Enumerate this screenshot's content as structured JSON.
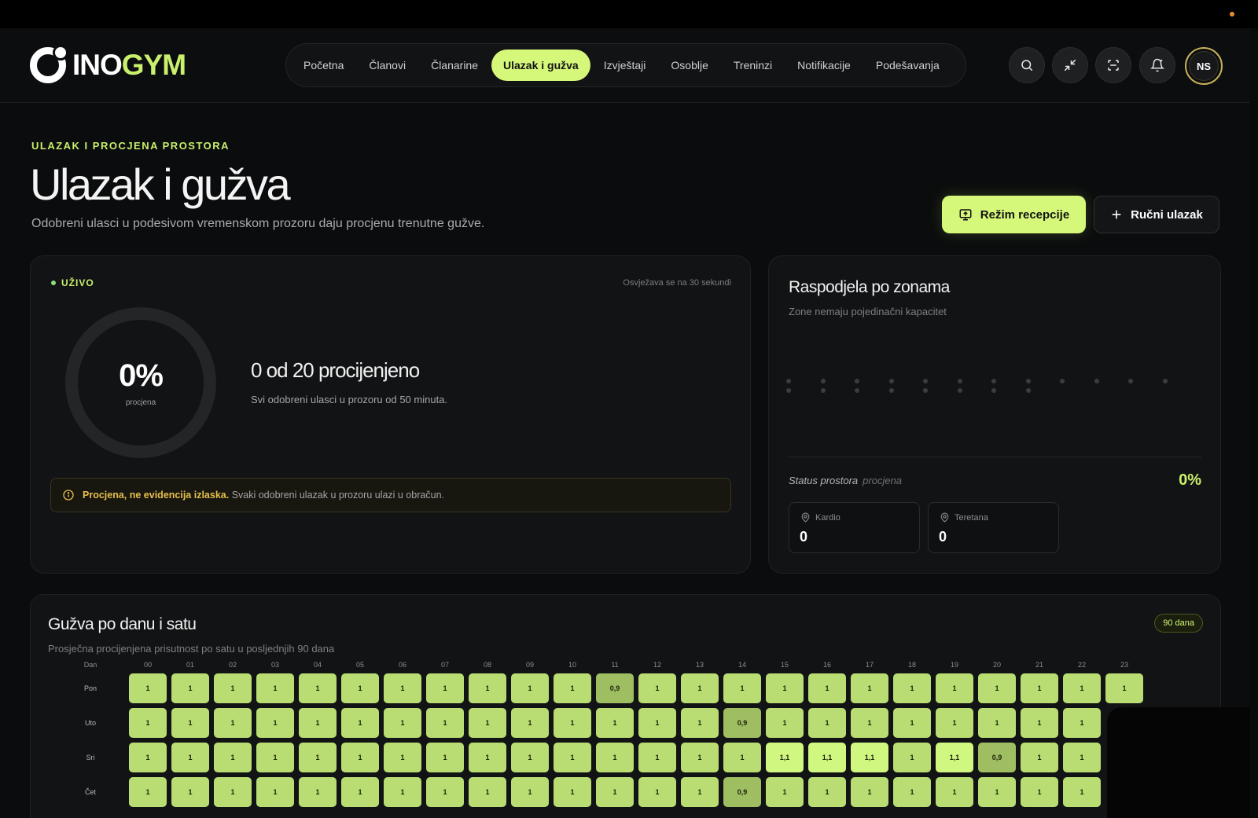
{
  "brand": {
    "logo_white": "INO",
    "logo_accent": "GYM",
    "accent": "#c9f06c"
  },
  "nav": [
    {
      "label": "Početna",
      "active": false
    },
    {
      "label": "Članovi",
      "active": false
    },
    {
      "label": "Članarine",
      "active": false
    },
    {
      "label": "Ulazak i gužva",
      "active": true
    },
    {
      "label": "Izvještaji",
      "active": false
    },
    {
      "label": "Osoblje",
      "active": false
    },
    {
      "label": "Treninzi",
      "active": false
    },
    {
      "label": "Notifikacije",
      "active": false
    },
    {
      "label": "Podešavanja",
      "active": false
    }
  ],
  "header_icons": [
    "search-icon",
    "collapse-icon",
    "scan-icon",
    "bell-icon"
  ],
  "user": {
    "initials": "NS"
  },
  "page": {
    "eyebrow": "ULAZAK I PROCJENA PROSTORA",
    "title": "Ulazak i gužva",
    "subtitle": "Odobreni ulasci u podesivom vremenskom prozoru daju procjenu trenutne gužve.",
    "primary_action": "Režim recepcije",
    "secondary_action": "Ručni ulazak"
  },
  "live": {
    "badge": "UŽIVO",
    "refresh": "Osvježava se na 30 sekundi",
    "gauge_value": "0%",
    "gauge_label": "procjena",
    "estimate": "0 od 20 procijenjeno",
    "estimate_sub": "Svi odobreni ulasci u prozoru od 50 minuta.",
    "note_bold": "Procjena, ne evidencija izlaska.",
    "note_text": " Svaki odobreni ulazak u prozoru ulazi u obračun."
  },
  "zones": {
    "title": "Raspodjela po zonama",
    "subtitle": "Zone nemaju pojedinačni kapacitet",
    "status_label": "Status prostora",
    "status_hint": "procjena",
    "status_value": "0%",
    "items": [
      {
        "name": "Kardio",
        "value": "0"
      },
      {
        "name": "Teretana",
        "value": "0"
      }
    ]
  },
  "heatmap": {
    "title": "Gužva po danu i satu",
    "subtitle": "Prosječna procijenjena prisutnost po satu u posljednjih 90 dana",
    "badge": "90 dana",
    "day_header": "Dan",
    "hours": [
      "00",
      "01",
      "02",
      "03",
      "04",
      "05",
      "06",
      "07",
      "08",
      "09",
      "10",
      "11",
      "12",
      "13",
      "14",
      "15",
      "16",
      "17",
      "18",
      "19",
      "20",
      "21",
      "22",
      "23"
    ],
    "rows": [
      {
        "day": "Pon",
        "values": [
          "1",
          "1",
          "1",
          "1",
          "1",
          "1",
          "1",
          "1",
          "1",
          "1",
          "1",
          "0,9",
          "1",
          "1",
          "1",
          "1",
          "1",
          "1",
          "1",
          "1",
          "1",
          "1",
          "1",
          "1"
        ]
      },
      {
        "day": "Uto",
        "values": [
          "1",
          "1",
          "1",
          "1",
          "1",
          "1",
          "1",
          "1",
          "1",
          "1",
          "1",
          "1",
          "1",
          "1",
          "0,9",
          "1",
          "1",
          "1",
          "1",
          "1",
          "1",
          "1",
          "1",
          ""
        ]
      },
      {
        "day": "Sri",
        "values": [
          "1",
          "1",
          "1",
          "1",
          "1",
          "1",
          "1",
          "1",
          "1",
          "1",
          "1",
          "1",
          "1",
          "1",
          "1",
          "1,1",
          "1,1",
          "1,1",
          "1",
          "1,1",
          "0,9",
          "1",
          "1",
          ""
        ]
      },
      {
        "day": "Čet",
        "values": [
          "1",
          "1",
          "1",
          "1",
          "1",
          "1",
          "1",
          "1",
          "1",
          "1",
          "1",
          "1",
          "1",
          "1",
          "0,9",
          "1",
          "1",
          "1",
          "1",
          "1",
          "1",
          "1",
          "1",
          ""
        ]
      }
    ]
  }
}
